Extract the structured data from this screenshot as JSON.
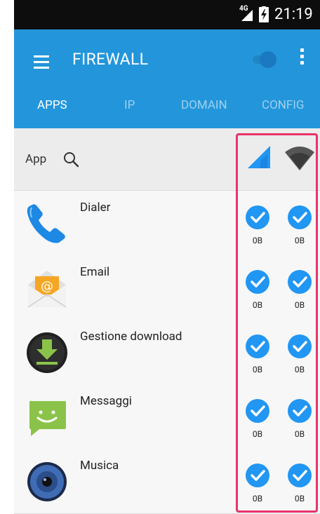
{
  "status_bar": {
    "network_type": "4G",
    "time": "21:19"
  },
  "app_bar": {
    "title": "FIREWALL",
    "toggle_state": "off",
    "tabs": [
      {
        "label": "APPS",
        "selected": true
      },
      {
        "label": "IP",
        "selected": false
      },
      {
        "label": "DOMAIN",
        "selected": false
      },
      {
        "label": "CONFIG",
        "selected": false
      }
    ]
  },
  "list_header": {
    "app_label": "App"
  },
  "apps": [
    {
      "name": "Dialer",
      "icon": "phone-icon",
      "mobile_allowed": true,
      "wifi_allowed": true,
      "mobile_bytes": "0B",
      "wifi_bytes": "0B"
    },
    {
      "name": "Email",
      "icon": "email-icon",
      "mobile_allowed": true,
      "wifi_allowed": true,
      "mobile_bytes": "0B",
      "wifi_bytes": "0B"
    },
    {
      "name": "Gestione download",
      "icon": "download-icon",
      "mobile_allowed": true,
      "wifi_allowed": true,
      "mobile_bytes": "0B",
      "wifi_bytes": "0B"
    },
    {
      "name": "Messaggi",
      "icon": "messaging-icon",
      "mobile_allowed": true,
      "wifi_allowed": true,
      "mobile_bytes": "0B",
      "wifi_bytes": "0B"
    },
    {
      "name": "Musica",
      "icon": "music-icon",
      "mobile_allowed": true,
      "wifi_allowed": true,
      "mobile_bytes": "0B",
      "wifi_bytes": "0B"
    }
  ],
  "colors": {
    "primary": "#2396db",
    "check": "#2196f3",
    "highlight": "#e8336b",
    "status_bar": "#0d0d0d"
  }
}
